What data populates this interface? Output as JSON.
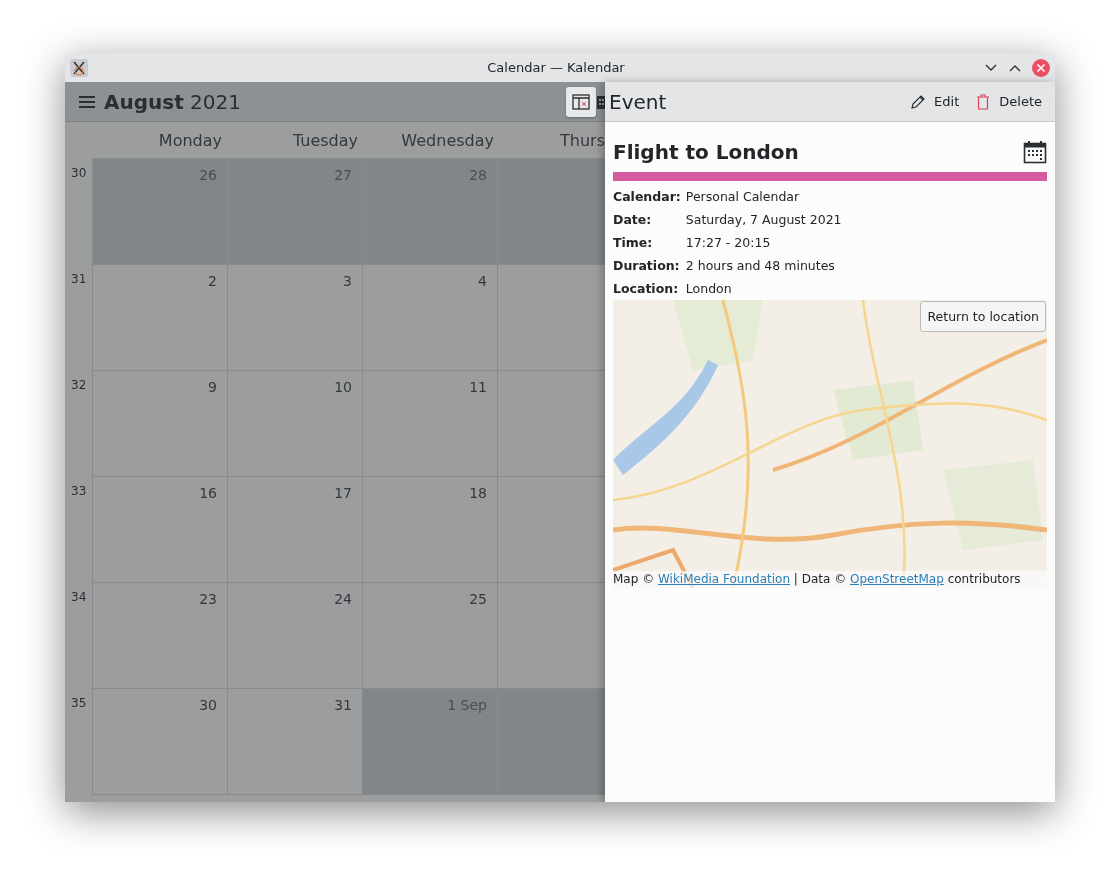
{
  "window": {
    "title": "Calendar — Kalendar"
  },
  "calendar": {
    "heading": "**August** 2021",
    "weekdays": [
      "Monday",
      "Tuesday",
      "Wednesday",
      "Thurs"
    ],
    "weeks": [
      {
        "number": "30",
        "days": [
          {
            "day": "26",
            "outside": true
          },
          {
            "day": "27",
            "outside": true
          },
          {
            "day": "28",
            "outside": true
          },
          {
            "outside": true
          }
        ]
      },
      {
        "number": "31",
        "days": [
          {
            "day": "2",
            "outside": false
          },
          {
            "day": "3",
            "outside": false
          },
          {
            "day": "4",
            "outside": false
          },
          {
            "outside": false
          }
        ]
      },
      {
        "number": "32",
        "days": [
          {
            "day": "9",
            "outside": false
          },
          {
            "day": "10",
            "outside": false
          },
          {
            "day": "11",
            "outside": false
          },
          {
            "outside": false
          }
        ]
      },
      {
        "number": "33",
        "days": [
          {
            "day": "16",
            "outside": false
          },
          {
            "day": "17",
            "outside": false
          },
          {
            "day": "18",
            "outside": false
          },
          {
            "outside": false
          }
        ]
      },
      {
        "number": "34",
        "days": [
          {
            "day": "23",
            "outside": false
          },
          {
            "day": "24",
            "outside": false
          },
          {
            "day": "25",
            "outside": false
          },
          {
            "outside": false
          }
        ]
      },
      {
        "number": "35",
        "days": [
          {
            "day": "30",
            "outside": false
          },
          {
            "day": "31",
            "outside": false
          },
          {
            "day": "1 Sep",
            "outside": true
          },
          {
            "outside": true
          }
        ]
      }
    ]
  },
  "drawer": {
    "title": "Event",
    "actions": [
      {
        "label": "Edit",
        "kind": "edit"
      },
      {
        "label": "Delete",
        "kind": "delete"
      }
    ],
    "event": {
      "title": "Flight to London",
      "color": "#d55aa0",
      "details": [
        {
          "label": "Calendar:",
          "value": "Personal Calendar"
        },
        {
          "label": "Date:",
          "value": "Saturday, 7 August 2021"
        },
        {
          "label": "Time:",
          "value": "17:27 - 20:15"
        },
        {
          "label": "Duration:",
          "value": "2 hours and 48 minutes"
        },
        {
          "label": "Location:",
          "value": "London"
        }
      ]
    },
    "map": {
      "kind": "picture",
      "button": "Return to location",
      "attribution": [
        {
          "kind": "text",
          "text": "Map © "
        },
        {
          "kind": "link",
          "text": "WikiMedia Foundation"
        },
        {
          "kind": "text",
          "text": " | Data © "
        },
        {
          "kind": "link",
          "text": "OpenStreetMap"
        },
        {
          "kind": "text",
          "text": " contributors"
        }
      ]
    }
  }
}
